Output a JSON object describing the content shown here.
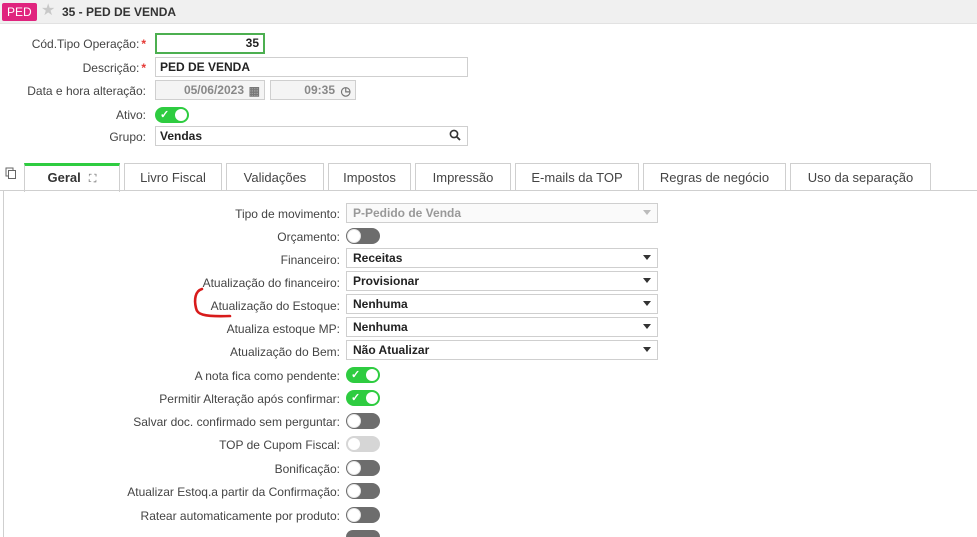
{
  "header": {
    "badge": "PED",
    "title": "35 - PED DE VENDA"
  },
  "form": {
    "cod_label": "Cód.Tipo Operação:",
    "cod_value": "35",
    "descricao_label": "Descrição:",
    "descricao_value": "PED DE VENDA",
    "datahora_label": "Data e hora alteração:",
    "data_value": "05/06/2023",
    "hora_value": "09:35",
    "ativo_label": "Ativo:",
    "grupo_label": "Grupo:",
    "grupo_value": "Vendas"
  },
  "tabs": [
    {
      "label": "Geral"
    },
    {
      "label": "Livro Fiscal"
    },
    {
      "label": "Validações"
    },
    {
      "label": "Impostos"
    },
    {
      "label": "Impressão"
    },
    {
      "label": "E-mails da TOP"
    },
    {
      "label": "Regras de negócio"
    },
    {
      "label": "Uso da separação"
    }
  ],
  "geral": {
    "tipo_movimento_label": "Tipo de movimento:",
    "tipo_movimento_value": "P-Pedido de Venda",
    "orcamento_label": "Orçamento:",
    "financeiro_label": "Financeiro:",
    "financeiro_value": "Receitas",
    "atualizacao_financeiro_label": "Atualização do financeiro:",
    "atualizacao_financeiro_value": "Provisionar",
    "atualizacao_estoque_label": "Atualização do Estoque:",
    "atualizacao_estoque_value": "Nenhuma",
    "atualiza_estoque_mp_label": "Atualiza estoque MP:",
    "atualiza_estoque_mp_value": "Nenhuma",
    "atualizacao_bem_label": "Atualização do Bem:",
    "atualizacao_bem_value": "Não Atualizar",
    "nota_pendente_label": "A nota fica como pendente:",
    "permitir_alteracao_label": "Permitir Alteração após confirmar:",
    "salvar_doc_label": "Salvar doc. confirmado sem perguntar:",
    "top_cupom_label": "TOP de Cupom Fiscal:",
    "bonificacao_label": "Bonificação:",
    "atualizar_estoq_label": "Atualizar Estoq.a partir da Confirmação:",
    "ratear_label": "Ratear automaticamente por produto:"
  },
  "colors": {
    "accent_green": "#2ecc40",
    "badge_pink": "#e0247e",
    "required_red": "#e53935"
  }
}
